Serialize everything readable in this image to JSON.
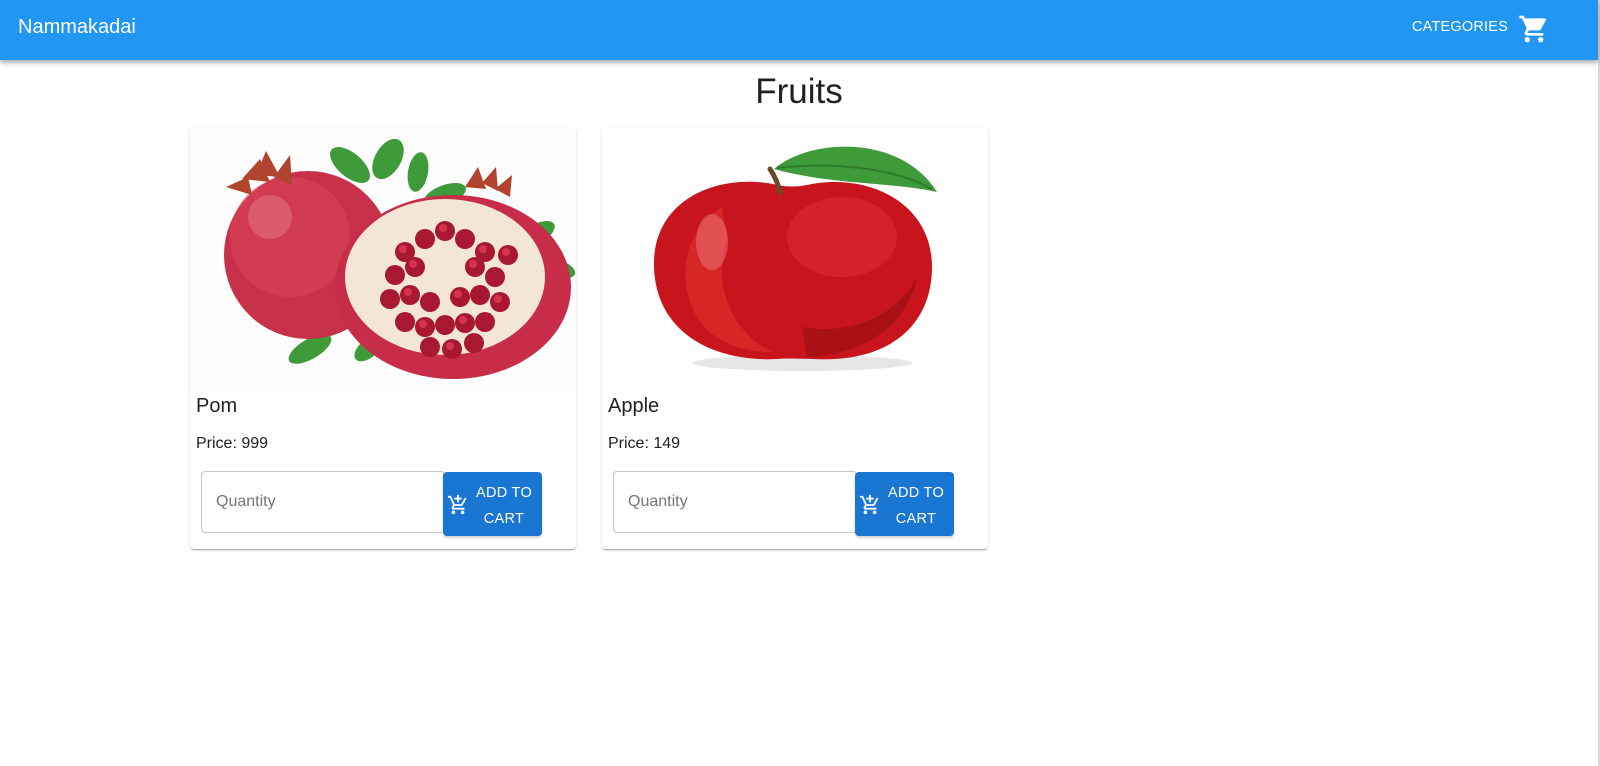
{
  "app": {
    "brand": "Nammakadai",
    "nav_categories": "CATEGORIES",
    "cart_icon": "shopping-cart-icon"
  },
  "colors": {
    "appbar": "#2196f3",
    "button": "#1976d2",
    "text": "#212121"
  },
  "page": {
    "title": "Fruits"
  },
  "products": [
    {
      "name": "Pom",
      "price_text": "Price: 999",
      "image": "pomegranate-image",
      "quantity_placeholder": "Quantity",
      "quantity_value": "",
      "button_label": "ADD TO CART",
      "button_icon": "add-shopping-cart-icon"
    },
    {
      "name": "Apple",
      "price_text": "Price: 149",
      "image": "apple-image",
      "quantity_placeholder": "Quantity",
      "quantity_value": "",
      "button_label": "ADD TO CART",
      "button_icon": "add-shopping-cart-icon"
    }
  ]
}
